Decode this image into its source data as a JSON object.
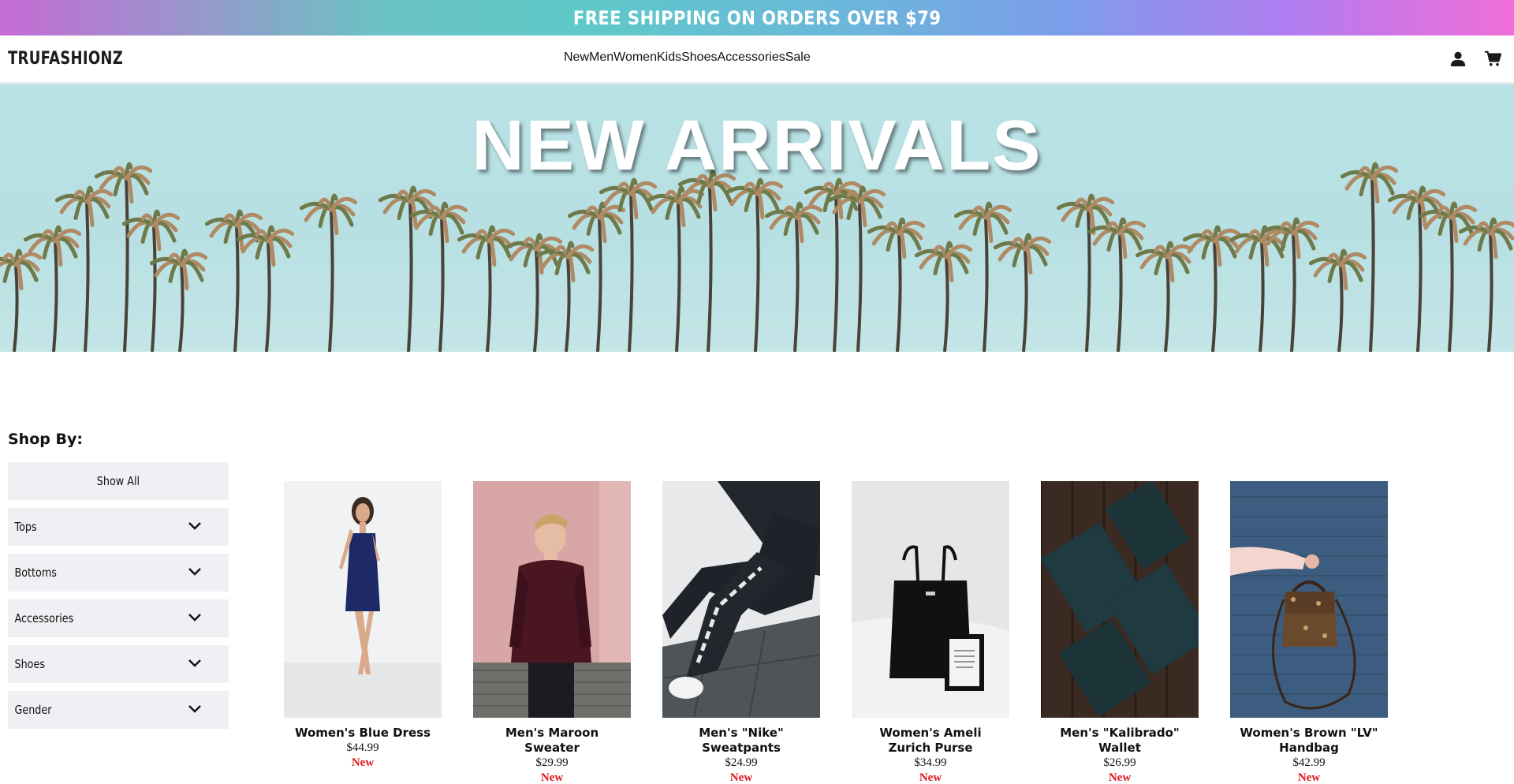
{
  "promo": {
    "text": "FREE SHIPPING ON ORDERS OVER $79"
  },
  "header": {
    "logo": "TRUFASHIONZ",
    "nav": [
      "New",
      "Men",
      "Women",
      "Kids",
      "Shoes",
      "Accessories",
      "Sale"
    ],
    "icons": [
      "user-icon",
      "cart-icon"
    ]
  },
  "hero": {
    "title": "NEW ARRIVALS"
  },
  "sidebar": {
    "heading": "Shop By:",
    "show_all": "Show All",
    "filters": [
      "Tops",
      "Bottoms",
      "Accessories",
      "Shoes",
      "Gender"
    ]
  },
  "products": [
    {
      "name": "Women's Blue Dress",
      "price": "$44.99",
      "badge": "New"
    },
    {
      "name": "Men's Maroon Sweater",
      "price": "$29.99",
      "badge": "New"
    },
    {
      "name": "Men's \"Nike\" Sweatpants",
      "price": "$24.99",
      "badge": "New"
    },
    {
      "name": "Women's Ameli Zurich Purse",
      "price": "$34.99",
      "badge": "New"
    },
    {
      "name": "Men's \"Kalibrado\" Wallet",
      "price": "$26.99",
      "badge": "New"
    },
    {
      "name": "Women's Brown \"LV\" Handbag",
      "price": "$42.99",
      "badge": "New"
    }
  ],
  "colors": {
    "sale": "#e0141b",
    "filter_bg": "#eff0f3",
    "sky": "#b9e2e6"
  }
}
